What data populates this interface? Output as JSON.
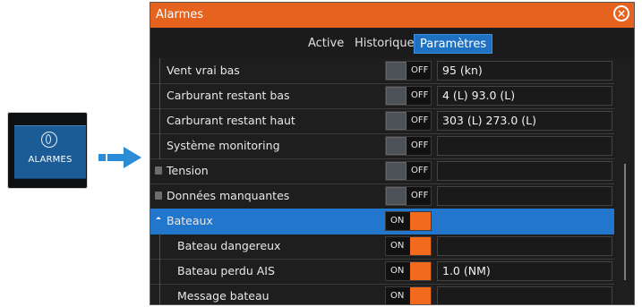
{
  "tile": {
    "label": "ALARMES",
    "icon": "alarm-icon"
  },
  "arrow": {
    "color": "#2a8cd6",
    "icon": "arrow-right-icon"
  },
  "dialog": {
    "title": "Alarmes",
    "close_icon": "close-icon",
    "accent": "#e6631f",
    "selected_color": "#2277cc",
    "tabs": [
      {
        "label": "Active",
        "selected": false
      },
      {
        "label": "Historique",
        "selected": false
      },
      {
        "label": "Paramètres",
        "selected": true
      }
    ],
    "rows": [
      {
        "label": "Vent vrai bas",
        "level": 1,
        "state": "OFF",
        "value": "95 (kn)"
      },
      {
        "label": "Carburant restant bas",
        "level": 1,
        "state": "OFF",
        "value": "4 (L)  93.0 (L)"
      },
      {
        "label": "Carburant restant haut",
        "level": 1,
        "state": "OFF",
        "value": "303 (L)  273.0 (L)"
      },
      {
        "label": "Système monitoring",
        "level": 1,
        "state": "OFF",
        "value": ""
      },
      {
        "label": "Tension",
        "level": 0,
        "expand": "collapsed",
        "state": "OFF",
        "value": ""
      },
      {
        "label": "Données manquantes",
        "level": 0,
        "expand": "collapsed",
        "state": "OFF",
        "value": ""
      },
      {
        "label": "Bateaux",
        "level": 0,
        "expand": "expanded",
        "state": "ON",
        "value": "",
        "selected": true
      },
      {
        "label": "Bateau dangereux",
        "level": 1,
        "state": "ON",
        "value": ""
      },
      {
        "label": "Bateau perdu AIS",
        "level": 1,
        "state": "ON",
        "value": "1.0 (NM)"
      },
      {
        "label": "Message bateau",
        "level": 1,
        "state": "ON",
        "value": ""
      }
    ]
  }
}
